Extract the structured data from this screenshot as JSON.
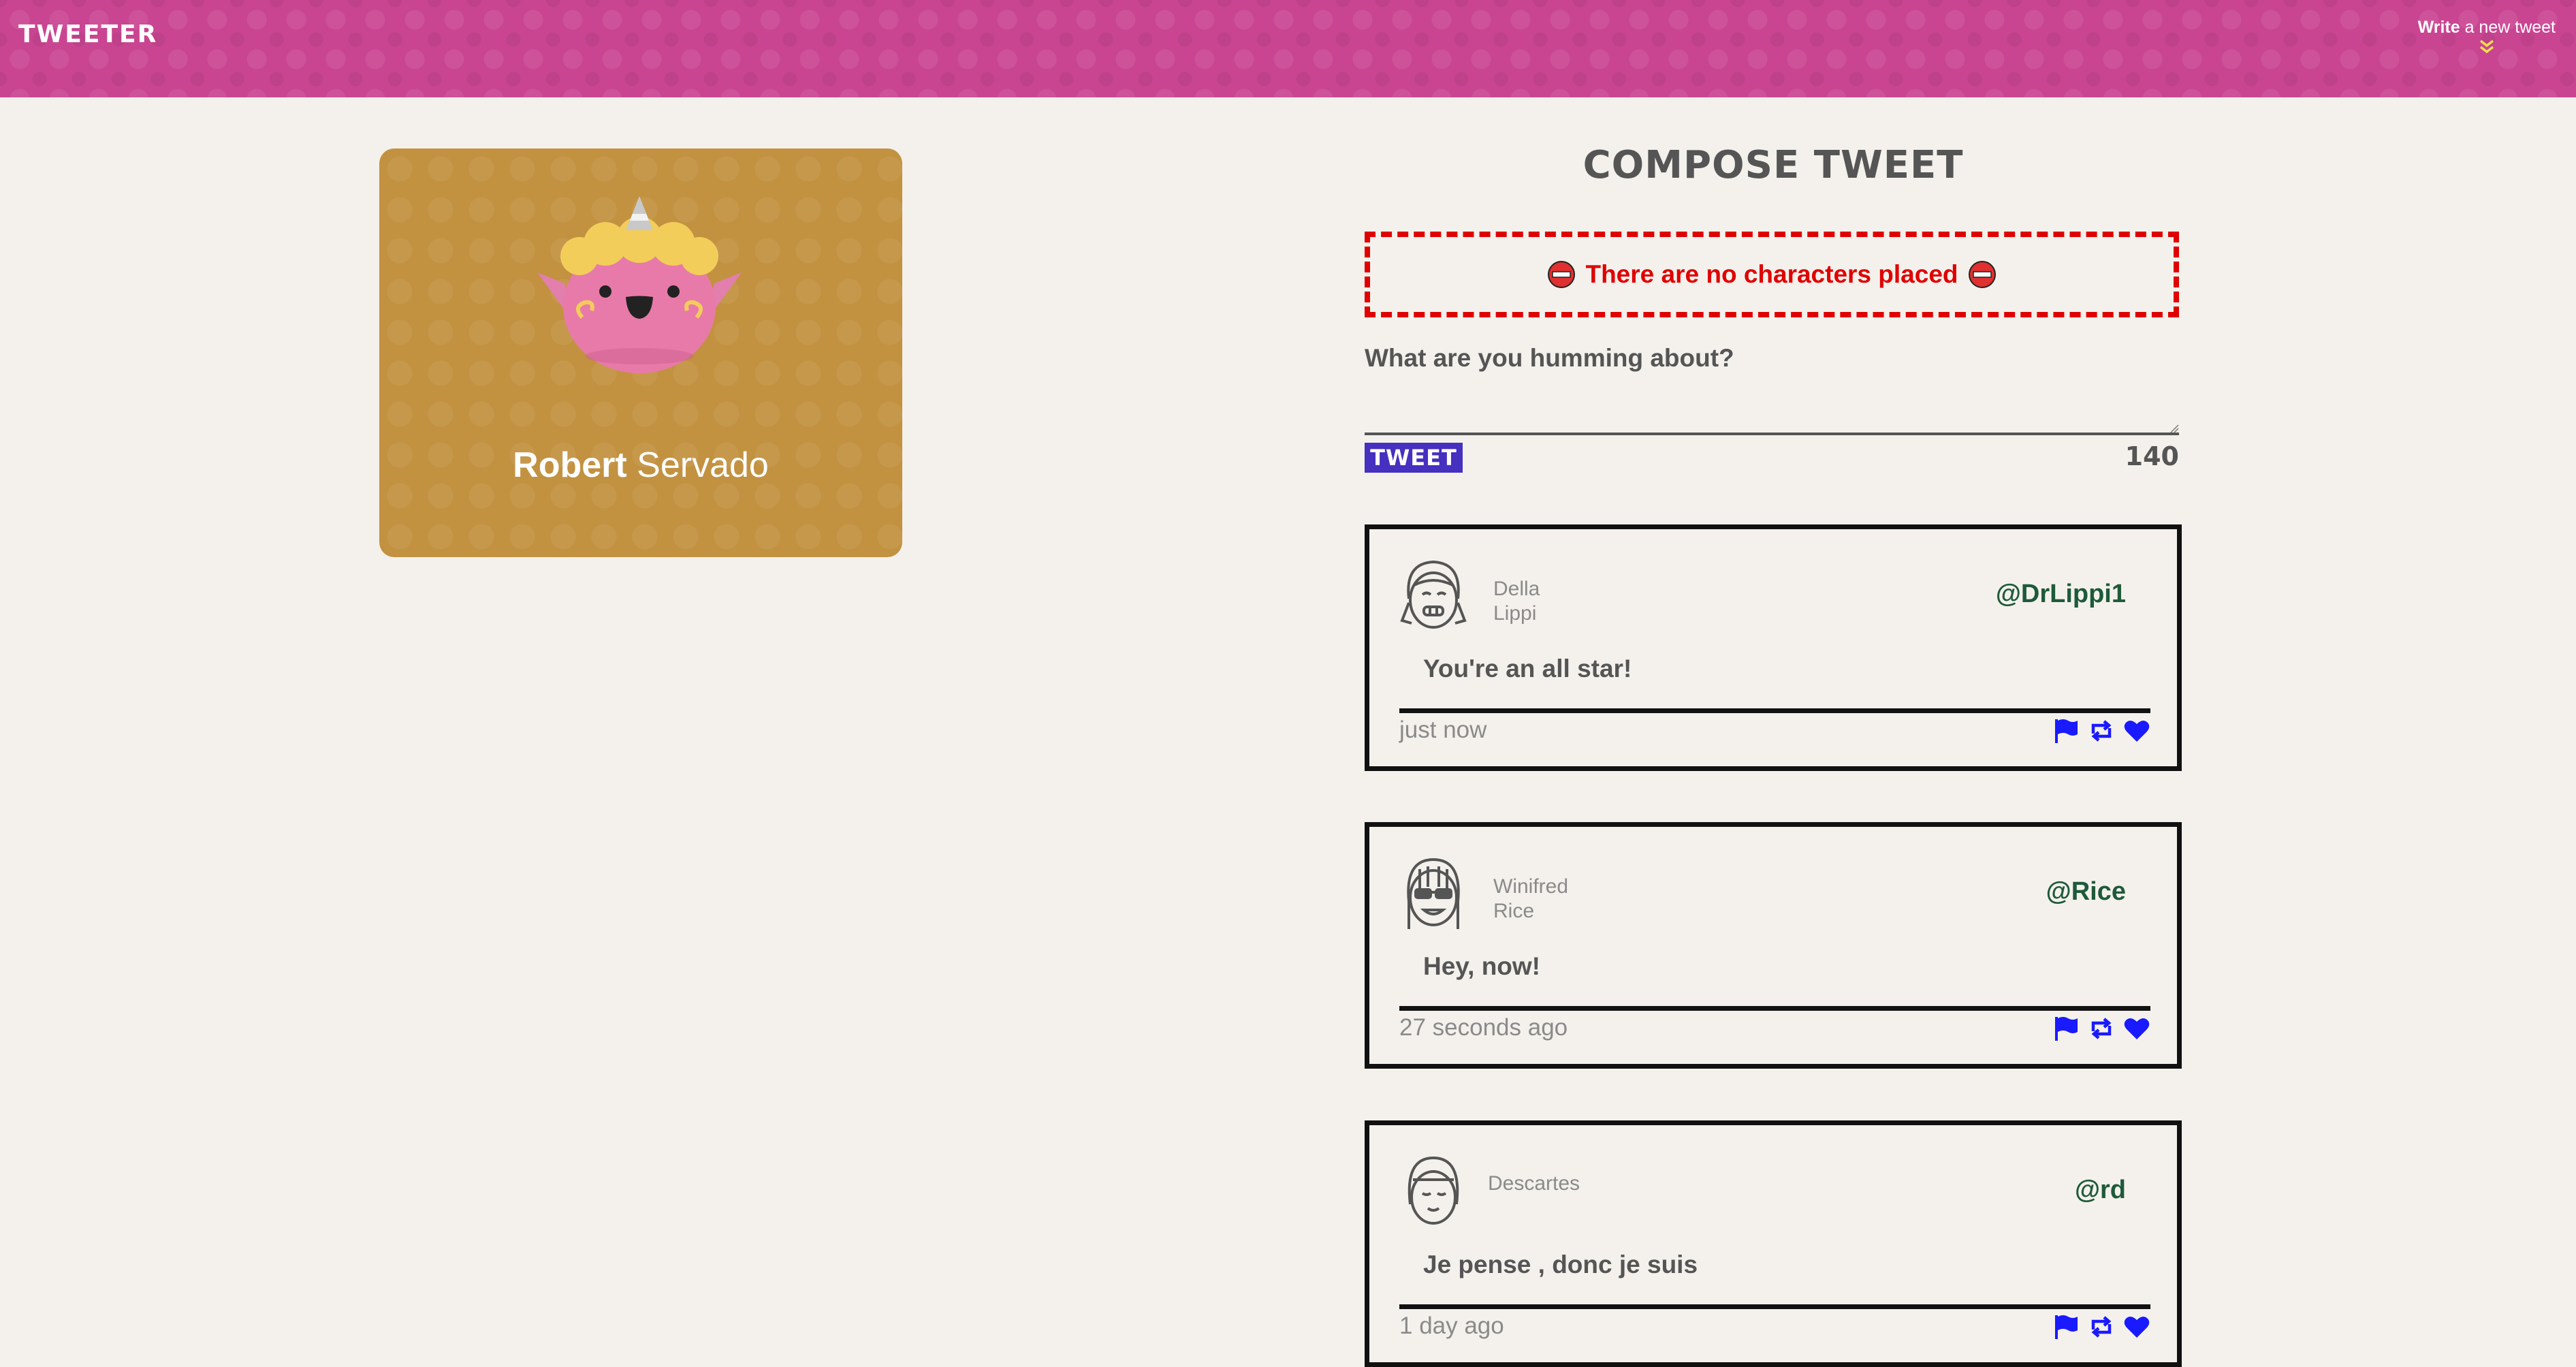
{
  "nav": {
    "brand": "TWEETER",
    "write_bold": "Write",
    "write_rest": " a new tweet",
    "accent_color": "#c94591"
  },
  "profile": {
    "first_name": "Robert",
    "last_name": " Servado",
    "card_color": "#c29241"
  },
  "compose": {
    "title": "COMPOSE TWEET",
    "error": "There are no characters placed",
    "prompt": "What are you humming about?",
    "input_value": "",
    "button_label": "TWEET",
    "counter": "140",
    "error_color": "#e00000",
    "button_color": "#4530c0"
  },
  "tweets": [
    {
      "first": "Della",
      "last": "Lippi",
      "handle": "@DrLippi1",
      "content": "You're an all star!",
      "time": "just now"
    },
    {
      "first": "Winifred",
      "last": "Rice",
      "handle": "@Rice",
      "content": "Hey, now!",
      "time": "27 seconds ago"
    },
    {
      "first": "Descartes",
      "last": "",
      "handle": "@rd",
      "content": "Je pense , donc je suis",
      "time": "1 day ago"
    }
  ],
  "icons": {
    "flag": "flag-icon",
    "retweet": "retweet-icon",
    "like": "heart-icon",
    "action_color": "#1a1aff"
  }
}
